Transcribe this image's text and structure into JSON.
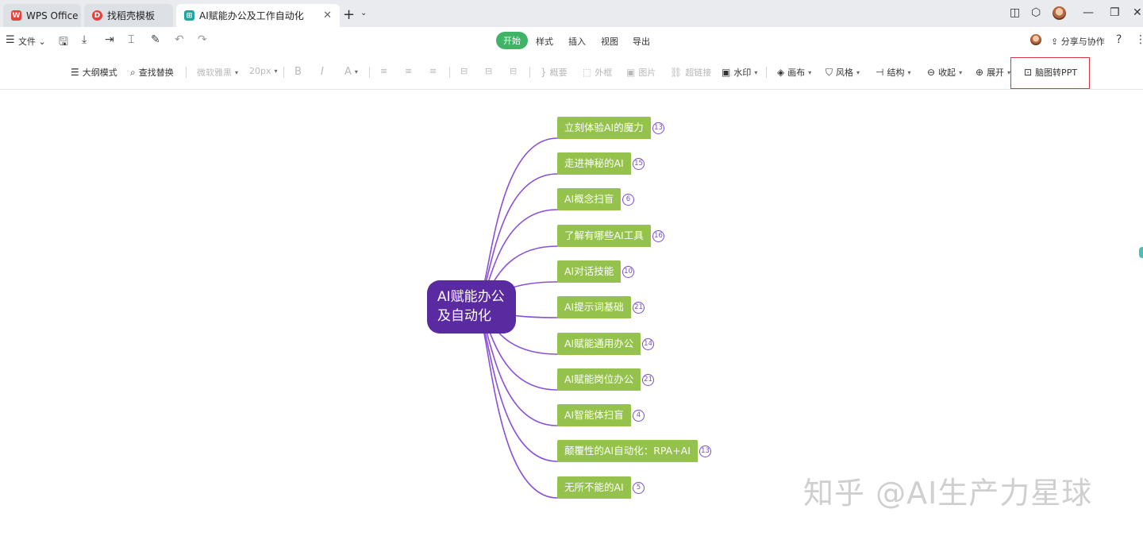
{
  "tabs": [
    {
      "label": "WPS Office"
    },
    {
      "label": "找稻壳模板"
    },
    {
      "label": "AI赋能办公及工作自动化"
    }
  ],
  "menu": {
    "file_label": "文件",
    "items": [
      "开始",
      "样式",
      "插入",
      "视图",
      "导出"
    ],
    "share_label": "分享与协作"
  },
  "toolbar": {
    "outline": "大纲模式",
    "find_replace": "查找替换",
    "font_family": "微软雅黑",
    "font_size": "20px",
    "bold": "B",
    "italic": "I",
    "font_color": "A",
    "summary": "概要",
    "frame": "外框",
    "image": "图片",
    "hyperlink": "超链接",
    "watermark": "水印",
    "canvas": "画布",
    "style": "风格",
    "structure": "结构",
    "collapse": "收起",
    "expand": "展开",
    "mindmap_to_ppt": "脑图转PPT"
  },
  "mindmap": {
    "root": [
      "AI赋能办公",
      "及自动化"
    ],
    "nodes": [
      {
        "label": "立刻体验AI的魔力",
        "count": "13"
      },
      {
        "label": "走进神秘的AI",
        "count": "15"
      },
      {
        "label": "AI概念扫盲",
        "count": "6"
      },
      {
        "label": "了解有哪些AI工具",
        "count": "16"
      },
      {
        "label": "AI对话技能",
        "count": "10"
      },
      {
        "label": "AI提示词基础",
        "count": "21"
      },
      {
        "label": "AI赋能通用办公",
        "count": "14"
      },
      {
        "label": "AI赋能岗位办公",
        "count": "21"
      },
      {
        "label": "AI智能体扫盲",
        "count": "4"
      },
      {
        "label": "颠覆性的AI自动化：RPA+AI",
        "count": "13"
      },
      {
        "label": "无所不能的AI",
        "count": "5"
      }
    ],
    "colors": {
      "root": "#5a2aa0",
      "node": "#94c24d",
      "line": "#8a4fd8"
    }
  },
  "watermark_text": "知乎 @AI生产力星球"
}
